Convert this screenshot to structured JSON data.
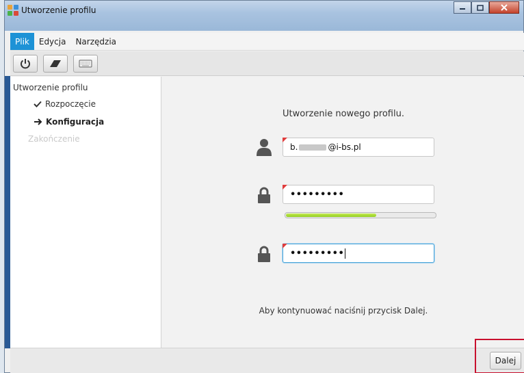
{
  "window": {
    "title": "Utworzenie profilu"
  },
  "menu": [
    {
      "label": "Plik",
      "active": true
    },
    {
      "label": "Edycja"
    },
    {
      "label": "Narzędzia"
    }
  ],
  "toolbar": [
    {
      "icon": "power-icon"
    },
    {
      "icon": "eraser-icon"
    },
    {
      "icon": "keyboard-icon"
    }
  ],
  "sidebar": {
    "root": "Utworzenie profilu",
    "steps": [
      {
        "label": "Rozpoczęcie",
        "status": "done",
        "icon": "checkmark-icon"
      },
      {
        "label": "Konfiguracja",
        "status": "current",
        "icon": "arrow-right-icon"
      },
      {
        "label": "Zakończenie",
        "status": "pending"
      }
    ]
  },
  "main": {
    "heading": "Utworzenie nowego profilu.",
    "email": {
      "prefix": "b.",
      "suffix": "@i-bs.pl",
      "icon": "user-icon"
    },
    "password": {
      "value": "•••••••••",
      "icon": "lock-icon"
    },
    "password_strength": 0.6,
    "password_confirm": {
      "value": "•••••••••",
      "icon": "lock-icon"
    },
    "hint": "Aby kontynuować naciśnij przycisk Dalej."
  },
  "footer": {
    "next_label": "Dalej"
  },
  "colors": {
    "accent": "#1d92d6",
    "strength": "#8fcc1e",
    "highlight": "#c8102e",
    "required": "#e03c3c"
  }
}
